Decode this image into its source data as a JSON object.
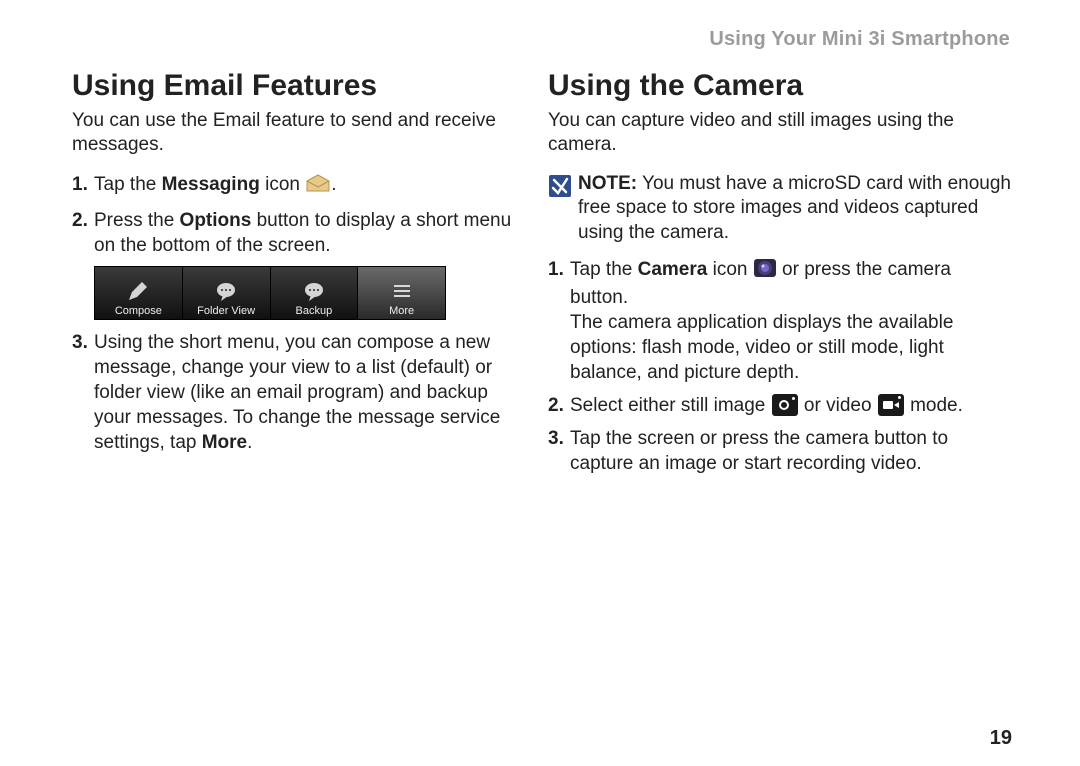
{
  "header": "Using Your Mini 3i Smartphone",
  "page_number": "19",
  "left": {
    "heading": "Using Email Features",
    "intro": "You can use the Email feature to send and receive messages.",
    "step1_a": "Tap the ",
    "step1_bold": "Messaging",
    "step1_b": " icon ",
    "step1_c": ".",
    "step2_a": "Press the ",
    "step2_bold": "Options",
    "step2_b": " button to display a short menu on the bottom of the screen.",
    "menu": {
      "compose": "Compose",
      "folderview": "Folder View",
      "backup": "Backup",
      "more": "More"
    },
    "step3_a": "Using the short menu, you can compose a new message, change your view to a list (default) or folder view (like an email program) and backup your messages. To change the message service settings, tap ",
    "step3_bold": "More",
    "step3_b": "."
  },
  "right": {
    "heading": "Using the Camera",
    "intro": "You can capture video and still images using the camera.",
    "note_label": "NOTE:",
    "note_text": " You must have a microSD card with enough free space to store images and videos captured using the camera.",
    "step1_a": "Tap the ",
    "step1_bold": "Camera",
    "step1_b": " icon ",
    "step1_c": " or press the camera button.",
    "step1_para2": "The camera application displays the available options: flash mode, video or still mode, light balance, and picture depth.",
    "step2_a": "Select either still image ",
    "step2_b": " or video ",
    "step2_c": " mode.",
    "step3": "Tap the screen or press the camera button to capture an image or start recording video."
  }
}
